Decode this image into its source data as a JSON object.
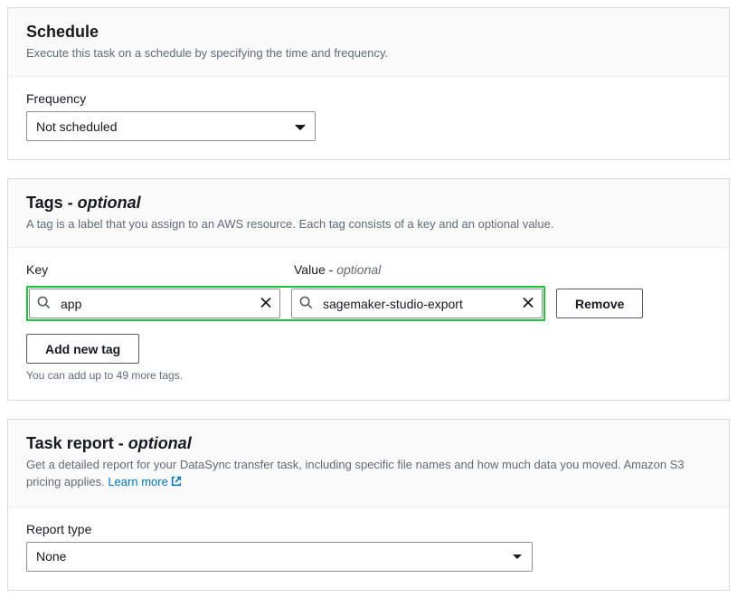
{
  "schedule": {
    "title": "Schedule",
    "desc": "Execute this task on a schedule by specifying the time and frequency.",
    "frequency_label": "Frequency",
    "frequency_value": "Not scheduled"
  },
  "tags": {
    "title_prefix": "Tags - ",
    "title_optional": "optional",
    "desc": "A tag is a label that you assign to an AWS resource. Each tag consists of a key and an optional value.",
    "key_label": "Key",
    "value_label_prefix": "Value - ",
    "value_label_optional": "optional",
    "rows": [
      {
        "key": "app",
        "value": "sagemaker-studio-export"
      }
    ],
    "remove_label": "Remove",
    "add_label": "Add new tag",
    "hint": "You can add up to 49 more tags."
  },
  "report": {
    "title_prefix": "Task report - ",
    "title_optional": "optional",
    "desc_part1": "Get a detailed report for your DataSync transfer task, including specific file names and how much data you moved. Amazon S3 pricing applies. ",
    "learn_more": "Learn more",
    "type_label": "Report type",
    "type_value": "None"
  }
}
